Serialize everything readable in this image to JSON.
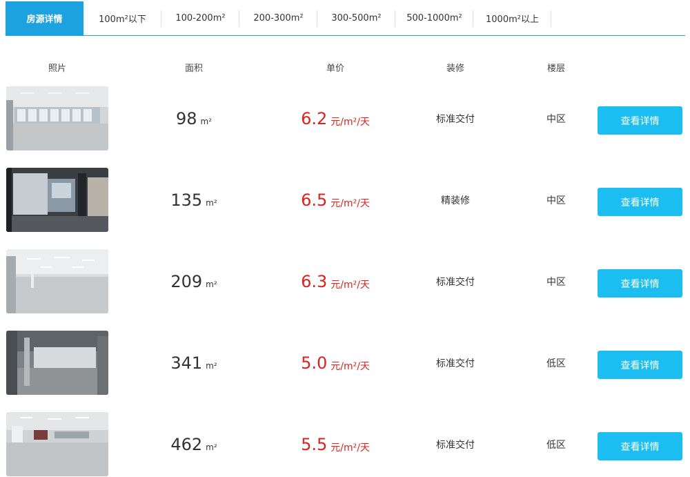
{
  "tabs": [
    {
      "label": "房源详情",
      "active": true
    },
    {
      "label": "100m²以下"
    },
    {
      "label": "100-200m²"
    },
    {
      "label": "200-300m²"
    },
    {
      "label": "300-500m²"
    },
    {
      "label": "500-1000m²"
    },
    {
      "label": "1000m²以上"
    }
  ],
  "headers": {
    "photo": "照片",
    "area": "面积",
    "price": "单价",
    "decoration": "装修",
    "floor": "楼层"
  },
  "listings": [
    {
      "area": "98",
      "area_unit": "m²",
      "price": "6.2",
      "price_unit": "元/m²/天",
      "decoration": "标准交付",
      "floor": "中区",
      "button": "查看详情"
    },
    {
      "area": "135",
      "area_unit": "m²",
      "price": "6.5",
      "price_unit": "元/m²/天",
      "decoration": "精装修",
      "floor": "中区",
      "button": "查看详情"
    },
    {
      "area": "209",
      "area_unit": "m²",
      "price": "6.3",
      "price_unit": "元/m²/天",
      "decoration": "标准交付",
      "floor": "中区",
      "button": "查看详情"
    },
    {
      "area": "341",
      "area_unit": "m²",
      "price": "5.0",
      "price_unit": "元/m²/天",
      "decoration": "标准交付",
      "floor": "低区",
      "button": "查看详情"
    },
    {
      "area": "462",
      "area_unit": "m²",
      "price": "5.5",
      "price_unit": "元/m²/天",
      "decoration": "标准交付",
      "floor": "低区",
      "button": "查看详情"
    }
  ],
  "colors": {
    "accent": "#1ba2df",
    "button": "#1cbdf0",
    "price": "#d6241f"
  }
}
